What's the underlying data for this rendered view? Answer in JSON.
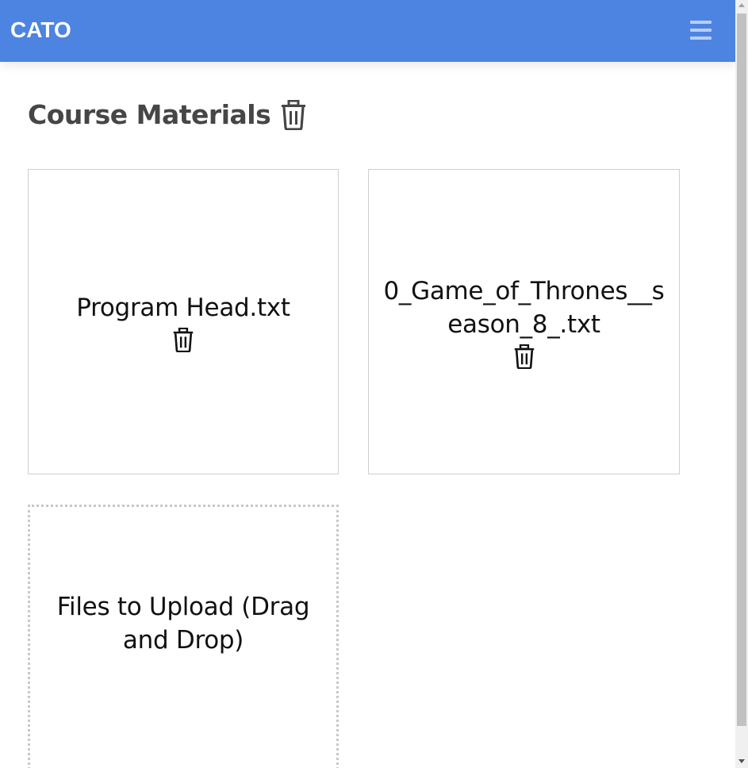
{
  "navbar": {
    "brand": "CATO",
    "menu_icon": "hamburger-menu-icon",
    "background_color": "#4d84e2"
  },
  "main": {
    "title": "Course Materials",
    "title_icon": "trash-icon",
    "files": [
      {
        "name": "Program Head.txt",
        "icon": "trash-icon"
      },
      {
        "name": "0_Game_of_Thrones__season_8_.txt",
        "icon": "trash-icon"
      }
    ],
    "dropzone": {
      "label": "Files to Upload (Drag and Drop)"
    }
  },
  "colors": {
    "accent": "#4d84e2",
    "title_text": "#464646",
    "card_border": "#cfcfcf"
  }
}
